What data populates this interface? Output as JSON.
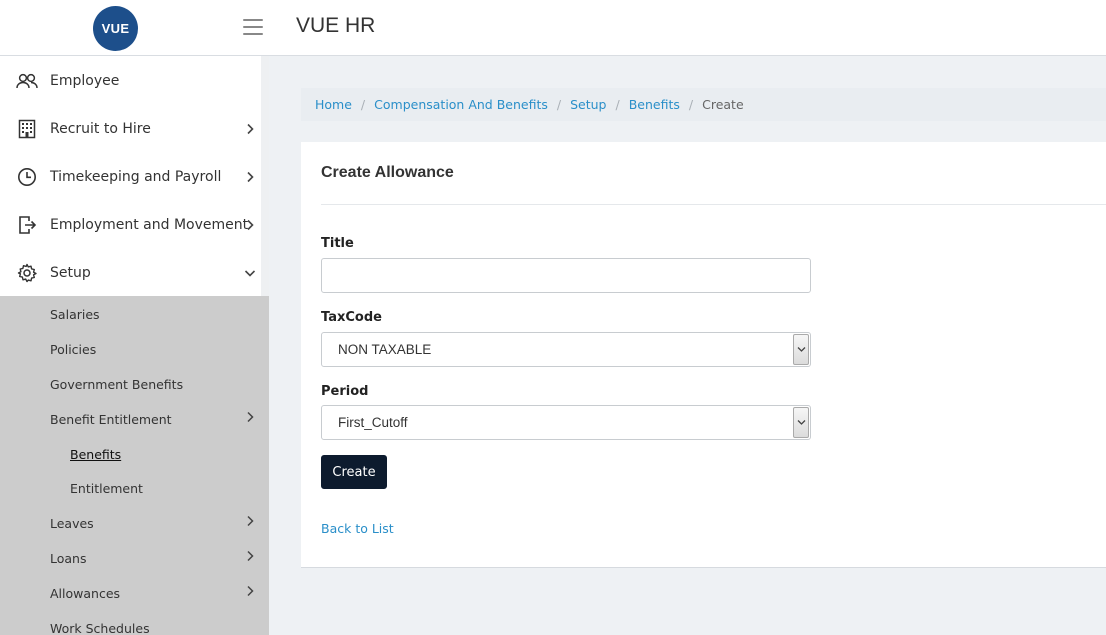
{
  "header": {
    "logo_text": "VUE",
    "app_title": "VUE HR"
  },
  "sidebar": {
    "items": [
      {
        "label": "Employee",
        "icon": "users-icon",
        "has_chevron": false
      },
      {
        "label": "Recruit to Hire",
        "icon": "building-icon",
        "has_chevron": true
      },
      {
        "label": "Timekeeping and Payroll",
        "icon": "clock-icon",
        "has_chevron": true
      },
      {
        "label": "Employment and Movement",
        "icon": "exit-icon",
        "has_chevron": true
      },
      {
        "label": "Setup",
        "icon": "gear-icon",
        "has_chevron": true,
        "expanded": true
      }
    ],
    "setup_submenu": [
      {
        "label": "Salaries"
      },
      {
        "label": "Policies"
      },
      {
        "label": "Government Benefits"
      },
      {
        "label": "Benefit Entitlement",
        "has_chevron": true
      },
      {
        "label": "Benefits",
        "child": true,
        "active": true
      },
      {
        "label": "Entitlement",
        "child": true
      },
      {
        "label": "Leaves",
        "has_chevron": true
      },
      {
        "label": "Loans",
        "has_chevron": true
      },
      {
        "label": "Allowances",
        "has_chevron": true
      },
      {
        "label": "Work Schedules"
      }
    ]
  },
  "breadcrumb": {
    "home": "Home",
    "compensation": "Compensation And Benefits",
    "setup": "Setup",
    "benefits": "Benefits",
    "current": "Create"
  },
  "form": {
    "title": "Create Allowance",
    "title_label": "Title",
    "title_value": "",
    "taxcode_label": "TaxCode",
    "taxcode_value": "NON TAXABLE",
    "period_label": "Period",
    "period_value": "First_Cutoff",
    "create_label": "Create",
    "back_label": "Back to List"
  },
  "colors": {
    "brand": "#1d4f8b",
    "link": "#2a8fc9",
    "primary_button": "#0d1b2e",
    "submenu_bg": "#cccccc"
  }
}
